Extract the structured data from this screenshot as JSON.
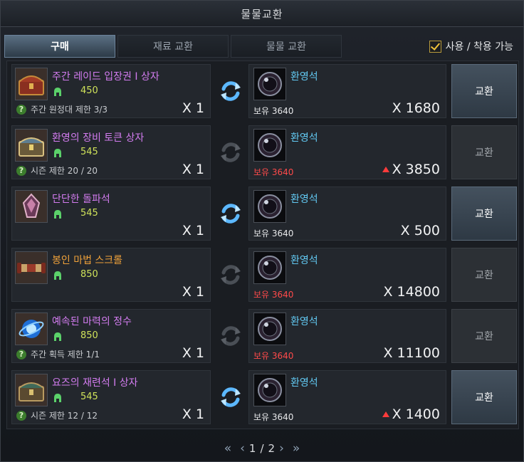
{
  "window": {
    "title": "물물교환"
  },
  "tabs": [
    "구매",
    "재료 교환",
    "물물 교환"
  ],
  "filter": {
    "label": "사용 / 착용 가능",
    "checked": true
  },
  "rows": [
    {
      "name": "주간 레이드 입장권 I 상자",
      "name_color": "purple",
      "price": "450",
      "limit": "주간 원정대 제한 3/3",
      "qty": "X 1",
      "icon": "red-chest-icon",
      "swap_active": true,
      "reward_name": "환영석",
      "owned": "보유 3640",
      "owned_low": false,
      "cost": "X 1680",
      "cost_up": false,
      "button": "교환",
      "enabled": true
    },
    {
      "name": "환영의 장비 토큰 상자",
      "name_color": "purple",
      "price": "545",
      "limit": "시즌 제한 20 / 20",
      "qty": "X 1",
      "icon": "blue-chest-icon",
      "swap_active": false,
      "reward_name": "환영석",
      "owned": "보유 3640",
      "owned_low": true,
      "cost": "X 3850",
      "cost_up": true,
      "button": "교환",
      "enabled": false
    },
    {
      "name": "단단한 돌파석",
      "name_color": "purple",
      "price": "545",
      "limit": "",
      "qty": "X 1",
      "icon": "crystal-icon",
      "swap_active": true,
      "reward_name": "환영석",
      "owned": "보유 3640",
      "owned_low": false,
      "cost": "X 500",
      "cost_up": false,
      "button": "교환",
      "enabled": true
    },
    {
      "name": "봉인 마법 스크롤",
      "name_color": "orange",
      "price": "850",
      "limit": "",
      "qty": "X 1",
      "icon": "scroll-icon",
      "swap_active": false,
      "reward_name": "환영석",
      "owned": "보유 3640",
      "owned_low": true,
      "cost": "X 14800",
      "cost_up": false,
      "button": "교환",
      "enabled": false
    },
    {
      "name": "예속된 마력의 정수",
      "name_color": "purple",
      "price": "850",
      "limit": "주간 획득 제한 1/1",
      "qty": "X 1",
      "icon": "orb-icon",
      "swap_active": false,
      "reward_name": "환영석",
      "owned": "보유 3640",
      "owned_low": true,
      "cost": "X 11100",
      "cost_up": false,
      "button": "교환",
      "enabled": false
    },
    {
      "name": "요즈의 재련석 I 상자",
      "name_color": "purple",
      "price": "545",
      "limit": "시즌 제한 12 / 12",
      "qty": "X 1",
      "icon": "green-chest-icon",
      "swap_active": true,
      "reward_name": "환영석",
      "owned": "보유 3640",
      "owned_low": false,
      "cost": "X 1400",
      "cost_up": true,
      "button": "교환",
      "enabled": true
    }
  ],
  "pager": {
    "current": "1",
    "total": "2",
    "separator": "/"
  }
}
